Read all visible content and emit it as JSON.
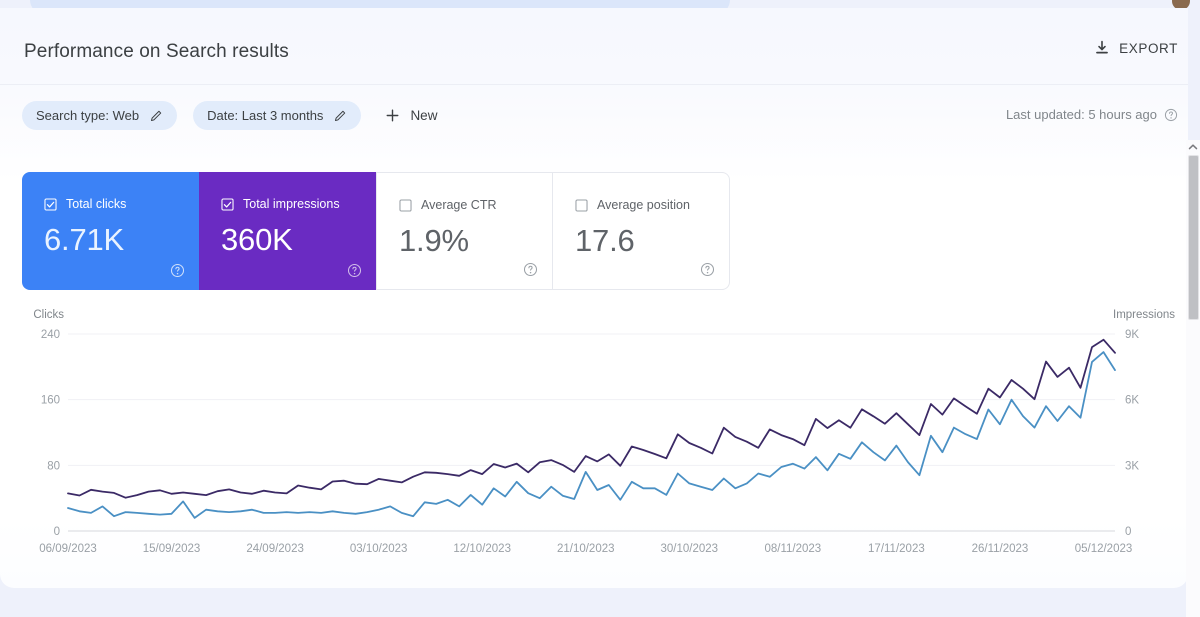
{
  "header": {
    "title": "Performance on Search results",
    "export_label": "EXPORT",
    "export_icon": "download-icon"
  },
  "filters": {
    "chips": [
      {
        "label": "Search type: Web",
        "icon": "pencil-icon"
      },
      {
        "label": "Date: Last 3 months",
        "icon": "pencil-icon"
      }
    ],
    "new_label": "New",
    "new_icon": "plus-icon",
    "last_updated": "Last updated: 5 hours ago",
    "help_icon": "help-circle-icon"
  },
  "metrics": [
    {
      "label": "Total clicks",
      "value": "6.71K",
      "selected": true,
      "color": "#3c82f6",
      "checkbox_icon": "checkbox-checked-icon",
      "help_icon": "help-circle-icon"
    },
    {
      "label": "Total impressions",
      "value": "360K",
      "selected": true,
      "color": "#6a2bc2",
      "checkbox_icon": "checkbox-checked-icon",
      "help_icon": "help-circle-icon"
    },
    {
      "label": "Average CTR",
      "value": "1.9%",
      "selected": false,
      "color": "#ffffff",
      "checkbox_icon": "checkbox-unchecked-icon",
      "help_icon": "help-circle-icon"
    },
    {
      "label": "Average position",
      "value": "17.6",
      "selected": false,
      "color": "#ffffff",
      "checkbox_icon": "checkbox-unchecked-icon",
      "help_icon": "help-circle-icon"
    }
  ],
  "scrollbar": {
    "up_arrow_icon": "chevron-up-icon"
  },
  "chart_data": {
    "type": "line",
    "title": "",
    "xlabel": "",
    "ylabel": "Clicks",
    "y2label": "Impressions",
    "ylim": [
      0,
      240
    ],
    "y2lim": [
      0,
      9000
    ],
    "yticks": [
      "0",
      "80",
      "160",
      "240"
    ],
    "y2ticks": [
      "0",
      "3K",
      "6K",
      "9K"
    ],
    "grid": true,
    "legend": "none",
    "xtick_labels": [
      "06/09/2023",
      "15/09/2023",
      "24/09/2023",
      "03/10/2023",
      "12/10/2023",
      "21/10/2023",
      "30/10/2023",
      "08/11/2023",
      "17/11/2023",
      "26/11/2023",
      "05/12/2023"
    ],
    "xtick_index": [
      0,
      9,
      18,
      27,
      36,
      45,
      54,
      63,
      72,
      81,
      90
    ],
    "series": [
      {
        "name": "Clicks",
        "color": "#4a90c4",
        "axis": "left",
        "values": [
          28,
          24,
          22,
          30,
          18,
          23,
          22,
          21,
          20,
          21,
          36,
          16,
          26,
          24,
          23,
          24,
          26,
          22,
          22,
          23,
          22,
          23,
          22,
          24,
          22,
          21,
          23,
          26,
          30,
          22,
          18,
          35,
          33,
          38,
          30,
          44,
          32,
          52,
          42,
          60,
          46,
          40,
          54,
          43,
          39,
          72,
          50,
          56,
          38,
          60,
          52,
          52,
          44,
          70,
          58,
          54,
          50,
          64,
          52,
          58,
          70,
          66,
          78,
          82,
          76,
          90,
          74,
          94,
          88,
          108,
          96,
          86,
          104,
          84,
          68,
          116,
          96,
          126,
          118,
          112,
          148,
          130,
          160,
          140,
          126,
          152,
          134,
          152,
          138,
          206,
          218,
          196
        ]
      },
      {
        "name": "Impressions",
        "color": "#3b2a66",
        "axis": "right",
        "values": [
          1720,
          1620,
          1880,
          1800,
          1740,
          1520,
          1640,
          1800,
          1860,
          1700,
          1760,
          1700,
          1640,
          1820,
          1900,
          1760,
          1700,
          1840,
          1760,
          1720,
          2080,
          1980,
          1900,
          2260,
          2300,
          2160,
          2140,
          2380,
          2300,
          2220,
          2480,
          2680,
          2660,
          2600,
          2520,
          2780,
          2600,
          3060,
          2900,
          3080,
          2680,
          3140,
          3240,
          3020,
          2700,
          3420,
          3180,
          3500,
          2980,
          3860,
          3700,
          3520,
          3320,
          4420,
          4020,
          3800,
          3540,
          4720,
          4300,
          4080,
          3800,
          4640,
          4380,
          4200,
          3920,
          5120,
          4700,
          5060,
          4720,
          5560,
          5240,
          4900,
          5380,
          4880,
          4380,
          5800,
          5320,
          6060,
          5700,
          5360,
          6500,
          6100,
          6900,
          6500,
          6020,
          7740,
          7040,
          7460,
          6540,
          8400,
          8740,
          8140
        ]
      }
    ]
  }
}
